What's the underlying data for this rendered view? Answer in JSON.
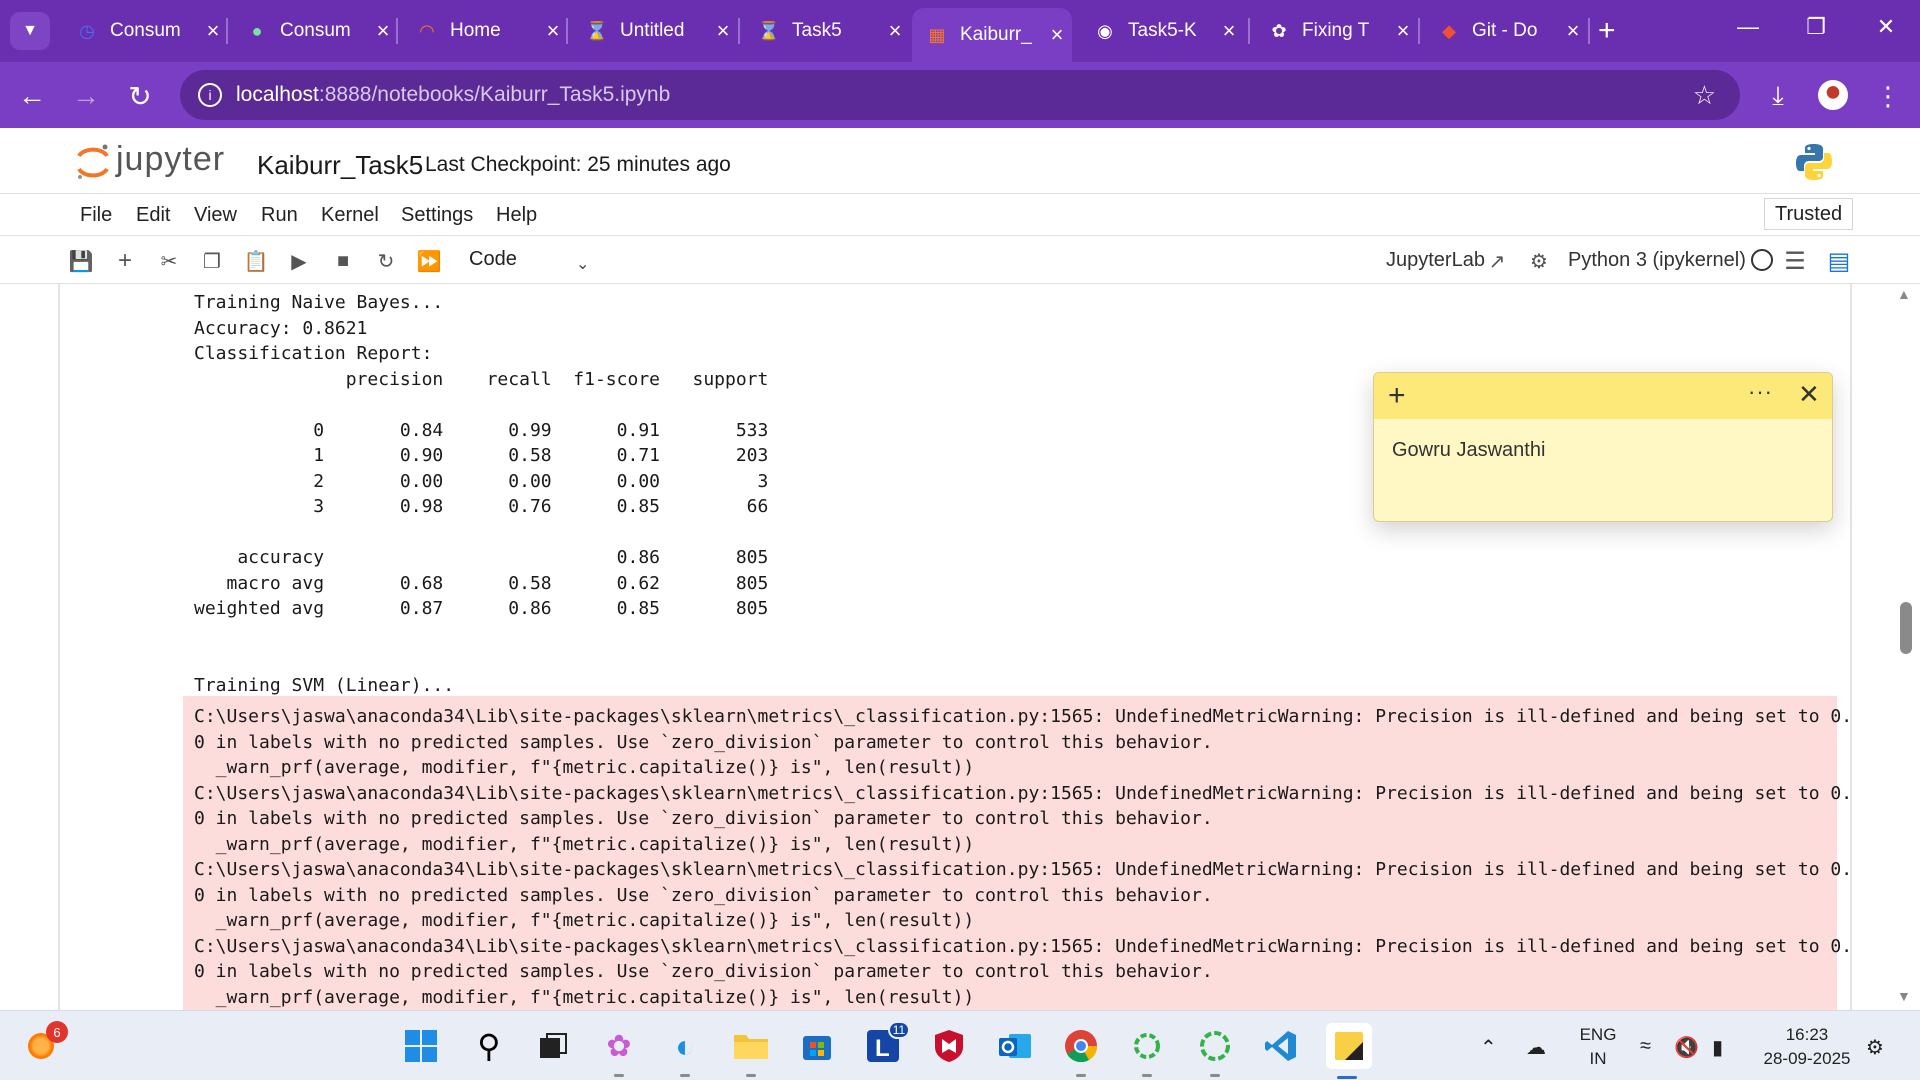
{
  "browser": {
    "tabs": [
      {
        "title": "Consum",
        "icon": "deepseek-icon",
        "active": false
      },
      {
        "title": "Consum",
        "icon": "copilot-icon",
        "active": false
      },
      {
        "title": "Home",
        "icon": "jupyter-icon",
        "active": false
      },
      {
        "title": "Untitled",
        "icon": "jupyter-hourglass-icon",
        "active": false
      },
      {
        "title": "Task5",
        "icon": "jupyter-hourglass-icon",
        "active": false
      },
      {
        "title": "Kaiburr_",
        "icon": "notebook-icon",
        "active": true
      },
      {
        "title": "Task5-K",
        "icon": "github-icon",
        "active": false
      },
      {
        "title": "Fixing T",
        "icon": "chatgpt-icon",
        "active": false
      },
      {
        "title": "Git - Do",
        "icon": "git-icon",
        "active": false
      }
    ],
    "url_host": "localhost",
    "url_path": ":8888/notebooks/Kaiburr_Task5.ipynb",
    "colors": {
      "chrome": "#6a2fb0",
      "toolbar": "#7a3ec4",
      "omnibox": "#5b2a96"
    }
  },
  "jupyter": {
    "logo_text": "jupyter",
    "notebook_title": "Kaiburr_Task5",
    "checkpoint": "Last Checkpoint: 25 minutes ago",
    "menu": [
      "File",
      "Edit",
      "View",
      "Run",
      "Kernel",
      "Settings",
      "Help"
    ],
    "trusted_label": "Trusted",
    "cell_type": "Code",
    "jupyterlab_label": "JupyterLab",
    "kernel_label": "Python 3 (ipykernel)"
  },
  "output": {
    "stdout_lines": [
      "Training Naive Bayes...",
      "Accuracy: 0.8621",
      "Classification Report:",
      "              precision    recall  f1-score   support",
      "",
      "           0       0.84      0.99      0.91       533",
      "           1       0.90      0.58      0.71       203",
      "           2       0.00      0.00      0.00         3",
      "           3       0.98      0.76      0.85        66",
      "",
      "    accuracy                           0.86       805",
      "   macro avg       0.68      0.58      0.62       805",
      "weighted avg       0.87      0.86      0.85       805",
      "",
      "",
      "Training SVM (Linear)..."
    ],
    "stderr_lines": [
      "C:\\Users\\jaswa\\anaconda34\\Lib\\site-packages\\sklearn\\metrics\\_classification.py:1565: UndefinedMetricWarning: Precision is ill-defined and being set to 0.",
      "0 in labels with no predicted samples. Use `zero_division` parameter to control this behavior.",
      "  _warn_prf(average, modifier, f\"{metric.capitalize()} is\", len(result))",
      "C:\\Users\\jaswa\\anaconda34\\Lib\\site-packages\\sklearn\\metrics\\_classification.py:1565: UndefinedMetricWarning: Precision is ill-defined and being set to 0.",
      "0 in labels with no predicted samples. Use `zero_division` parameter to control this behavior.",
      "  _warn_prf(average, modifier, f\"{metric.capitalize()} is\", len(result))",
      "C:\\Users\\jaswa\\anaconda34\\Lib\\site-packages\\sklearn\\metrics\\_classification.py:1565: UndefinedMetricWarning: Precision is ill-defined and being set to 0.",
      "0 in labels with no predicted samples. Use `zero_division` parameter to control this behavior.",
      "  _warn_prf(average, modifier, f\"{metric.capitalize()} is\", len(result))",
      "C:\\Users\\jaswa\\anaconda34\\Lib\\site-packages\\sklearn\\metrics\\_classification.py:1565: UndefinedMetricWarning: Precision is ill-defined and being set to 0.",
      "0 in labels with no predicted samples. Use `zero_division` parameter to control this behavior.",
      "  _warn_prf(average, modifier, f\"{metric.capitalize()} is\", len(result))"
    ],
    "stderr_color": "#fddcdc"
  },
  "sticky_note": {
    "text": "Gowru Jaswanthi",
    "header_color": "#fde97a",
    "body_color": "#fff8c4"
  },
  "taskbar": {
    "weather_badge": "6",
    "l_app_badge": "11",
    "lang_top": "ENG",
    "lang_bottom": "IN",
    "time": "16:23",
    "date": "28-09-2025"
  }
}
